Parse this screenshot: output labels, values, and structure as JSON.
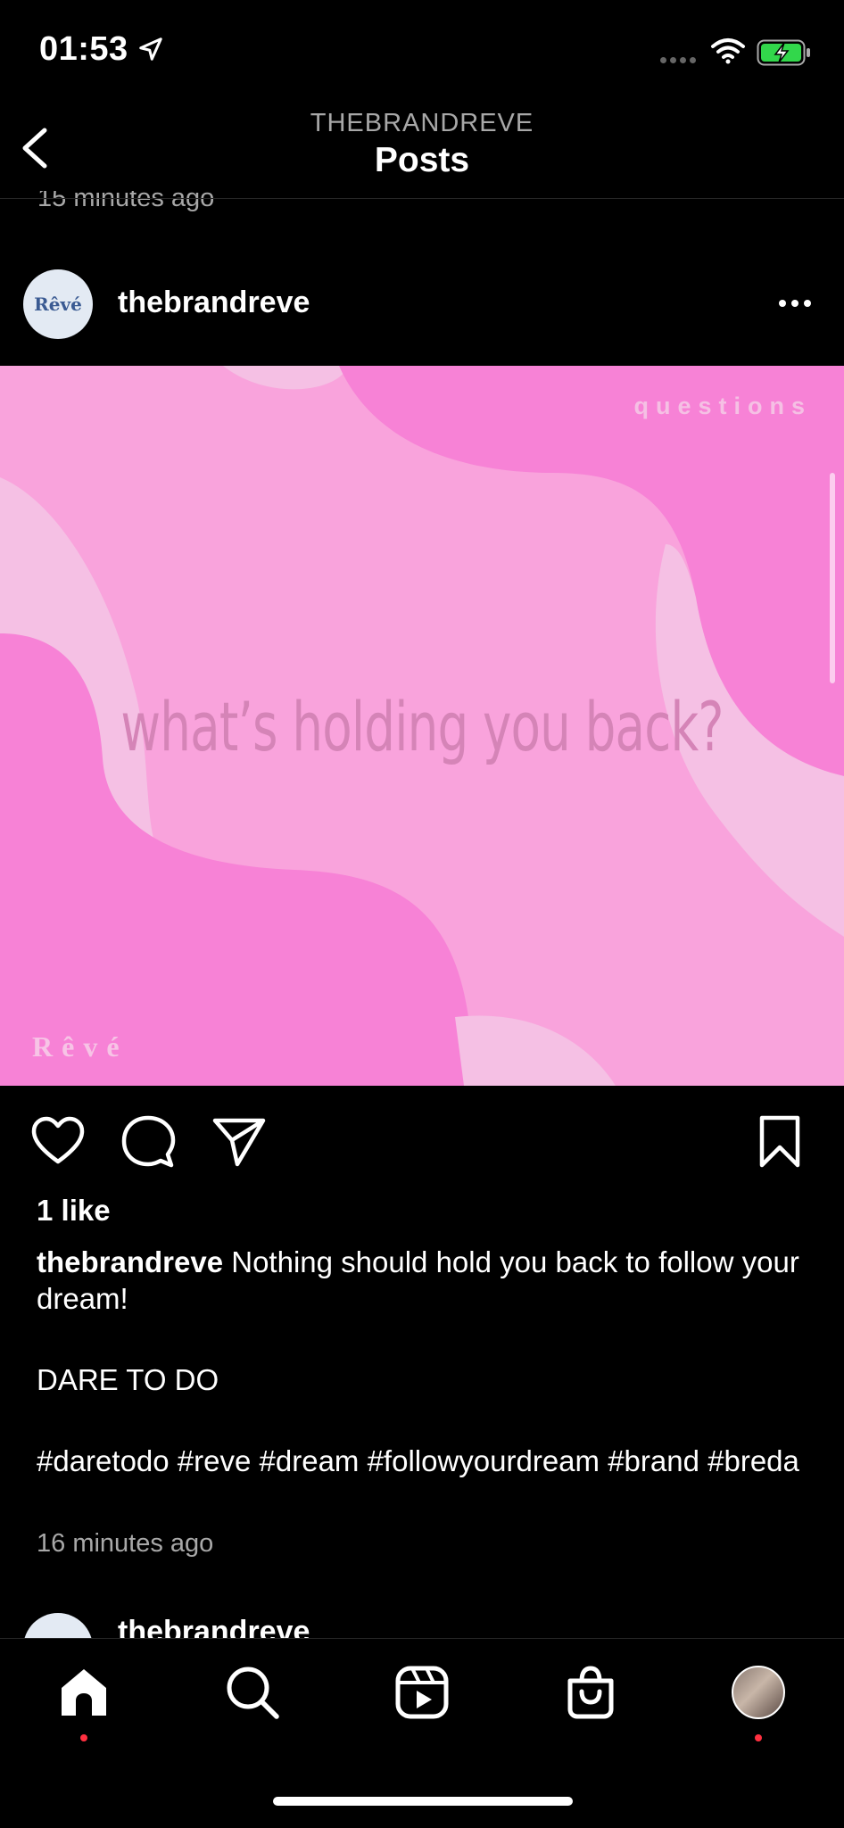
{
  "status_bar": {
    "time": "01:53"
  },
  "header": {
    "account": "THEBRANDREVE",
    "title": "Posts"
  },
  "previous_post": {
    "time": "15 minutes ago"
  },
  "post": {
    "username": "thebrandreve",
    "avatar_text": "Rêvé",
    "image": {
      "tag": "questions",
      "quote": "what’s holding you back?",
      "logo": "Rêvé",
      "colors": {
        "base": "#f9a3dc",
        "dark": "#f782d6",
        "light": "#f5c0e4"
      }
    },
    "likes": "1 like",
    "caption": {
      "username": "thebrandreve",
      "line1": "Nothing should hold you back to follow your dream!",
      "line2": "DARE TO DO",
      "hashtags": "#daretodo #reve #dream #followyourdream #brand #breda"
    },
    "time": "16 minutes ago"
  },
  "next_post": {
    "username": "thebrandreve"
  },
  "tabs": [
    {
      "name": "home",
      "icon": "home-icon",
      "active": true
    },
    {
      "name": "search",
      "icon": "search-icon"
    },
    {
      "name": "reels",
      "icon": "reels-icon"
    },
    {
      "name": "shop",
      "icon": "shop-icon"
    },
    {
      "name": "profile",
      "icon": "profile-avatar"
    }
  ],
  "accent": "#ff3040"
}
